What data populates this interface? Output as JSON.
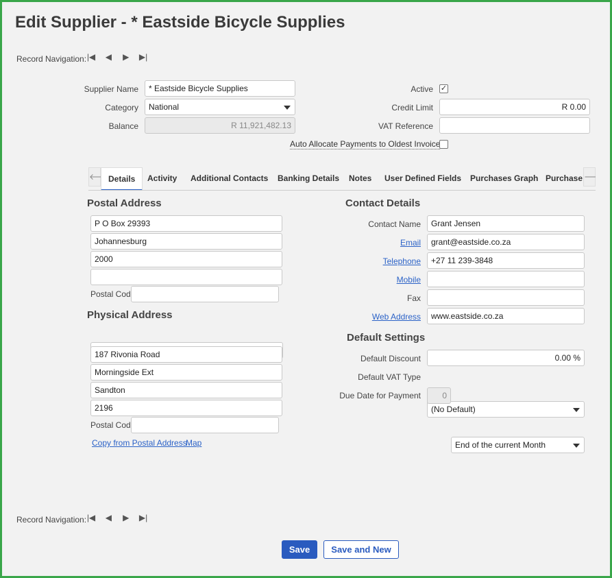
{
  "page": {
    "title": "Edit Supplier - * Eastside Bicycle Supplies"
  },
  "record_nav": {
    "label": "Record Navigation:",
    "first": "|◀",
    "prev": "◀",
    "next": "▶",
    "last": "▶|"
  },
  "form": {
    "supplier_name_label": "Supplier Name",
    "supplier_name": "* Eastside Bicycle Supplies",
    "category_label": "Category",
    "category": "National",
    "balance_label": "Balance",
    "balance": "R 11,921,482.13",
    "active_label": "Active",
    "active_checked": "✓",
    "credit_limit_label": "Credit Limit",
    "credit_limit": "R 0.00",
    "vat_reference_label": "VAT Reference",
    "vat_reference": "",
    "auto_allocate_label": "Auto Allocate Payments to Oldest Invoice",
    "auto_allocate_checked": ""
  },
  "tabs": [
    {
      "label": "Details"
    },
    {
      "label": "Activity"
    },
    {
      "label": "Additional Contacts"
    },
    {
      "label": "Banking Details"
    },
    {
      "label": "Notes"
    },
    {
      "label": "User Defined Fields"
    },
    {
      "label": "Purchases Graph"
    },
    {
      "label": "Purchase C"
    }
  ],
  "tab_arrows": {
    "left": "🡐",
    "right": "🡒"
  },
  "postal": {
    "heading": "Postal Address",
    "line1": "P O Box 29393",
    "line2": "Johannesburg",
    "line3": "2000",
    "line4": "",
    "postal_code_label": "Postal Code",
    "postal_code": ""
  },
  "physical": {
    "heading": "Physical Address",
    "type": "Physical Address",
    "line1": "187 Rivonia Road",
    "line2": "Morningside Ext",
    "line3": "Sandton",
    "line4": "2196",
    "postal_code_label": "Postal Code",
    "postal_code": "",
    "copy_link": "Copy from Postal Address",
    "map_link": "Map"
  },
  "contact": {
    "heading": "Contact Details",
    "contact_name_label": "Contact Name",
    "contact_name": "Grant Jensen",
    "email_label": "Email",
    "email": "grant@eastside.co.za",
    "telephone_label": "Telephone",
    "telephone": "+27 11 239-3848",
    "mobile_label": "Mobile",
    "mobile": "",
    "fax_label": "Fax",
    "fax": "",
    "web_label": "Web Address",
    "web": "www.eastside.co.za"
  },
  "defaults": {
    "heading": "Default Settings",
    "discount_label": "Default Discount",
    "discount": "0.00 %",
    "vat_type_label": "Default VAT Type",
    "vat_type": "(No Default)",
    "due_date_label": "Due Date for Payment",
    "due_days": "0",
    "due_option": "End of the current Month"
  },
  "buttons": {
    "save": "Save",
    "save_new": "Save and New"
  }
}
